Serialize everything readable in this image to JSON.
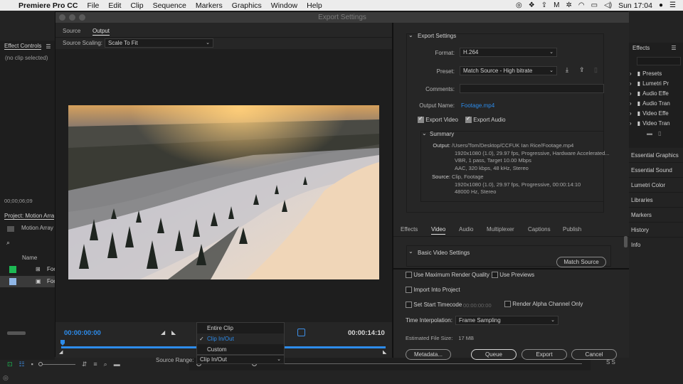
{
  "menubar": {
    "app": "Premiere Pro CC",
    "items": [
      "File",
      "Edit",
      "Clip",
      "Sequence",
      "Markers",
      "Graphics",
      "Window",
      "Help"
    ],
    "clock": "Sun 17:04"
  },
  "bg_left": {
    "effect_controls_tab": "Effect Controls",
    "no_clip": "(no clip selected)",
    "timecode": "00;00;06;09",
    "project_tab": "Project: Motion Arra",
    "project_name": "Motion Array",
    "name_header": "Name",
    "row1": "Foo",
    "row2": "Foo"
  },
  "bg_right": {
    "effects_tab": "Effects",
    "tree": [
      "Presets",
      "Lumetri Pr",
      "Audio Effe",
      "Audio Tran",
      "Video Effe",
      "Video Tran"
    ],
    "panels": [
      "Essential Graphics",
      "Essential Sound",
      "Lumetri Color",
      "Libraries",
      "Markers",
      "History",
      "Info"
    ],
    "ss": "S S"
  },
  "dialog": {
    "title": "Export Settings",
    "left": {
      "tabs": [
        "Source",
        "Output"
      ],
      "active_tab": "Output",
      "source_scaling_label": "Source Scaling:",
      "source_scaling_value": "Scale To Fit",
      "tc_in": "00:00:00:00",
      "tc_out": "00:00:14:10",
      "source_range_label": "Source Range:",
      "source_range_value": "Clip In/Out",
      "range_menu": [
        "Entire Clip",
        "Clip In/Out",
        "Custom"
      ],
      "range_selected": "Clip In/Out"
    },
    "right": {
      "export_settings_header": "Export Settings",
      "format_label": "Format:",
      "format_value": "H.264",
      "preset_label": "Preset:",
      "preset_value": "Match Source - High bitrate",
      "comments_label": "Comments:",
      "output_name_label": "Output Name:",
      "output_name_value": "Footage.mp4",
      "export_video": "Export Video",
      "export_audio": "Export Audio",
      "summary_header": "Summary",
      "summary_output_label": "Output:",
      "summary_output": [
        "/Users/Tom/Desktop/CCFUK Ian Rice/Footage.mp4",
        "1920x1080 (1.0), 29.97 fps, Progressive, Hardware Accelerated...",
        "VBR, 1 pass, Target 10.00 Mbps",
        "AAC, 320 kbps, 48 kHz, Stereo"
      ],
      "summary_source_label": "Source:",
      "summary_source": [
        "Clip, Footage",
        "1920x1080 (1.0), 29.97 fps, Progressive, 00:00:14:10",
        "48000 Hz, Stereo"
      ],
      "tabs": [
        "Effects",
        "Video",
        "Audio",
        "Multiplexer",
        "Captions",
        "Publish"
      ],
      "active_tab": "Video",
      "basic_video_header": "Basic Video Settings",
      "match_source_button": "Match Source",
      "use_max_render": "Use Maximum Render Quality",
      "use_previews": "Use Previews",
      "import_into_project": "Import Into Project",
      "set_start_timecode": "Set Start Timecode",
      "start_timecode_value": "00:00:00:00",
      "render_alpha": "Render Alpha Channel Only",
      "time_interp_label": "Time Interpolation:",
      "time_interp_value": "Frame Sampling",
      "est_size_label": "Estimated File Size:",
      "est_size_value": "17 MB",
      "buttons": {
        "metadata": "Metadata...",
        "queue": "Queue",
        "export": "Export",
        "cancel": "Cancel"
      }
    }
  }
}
